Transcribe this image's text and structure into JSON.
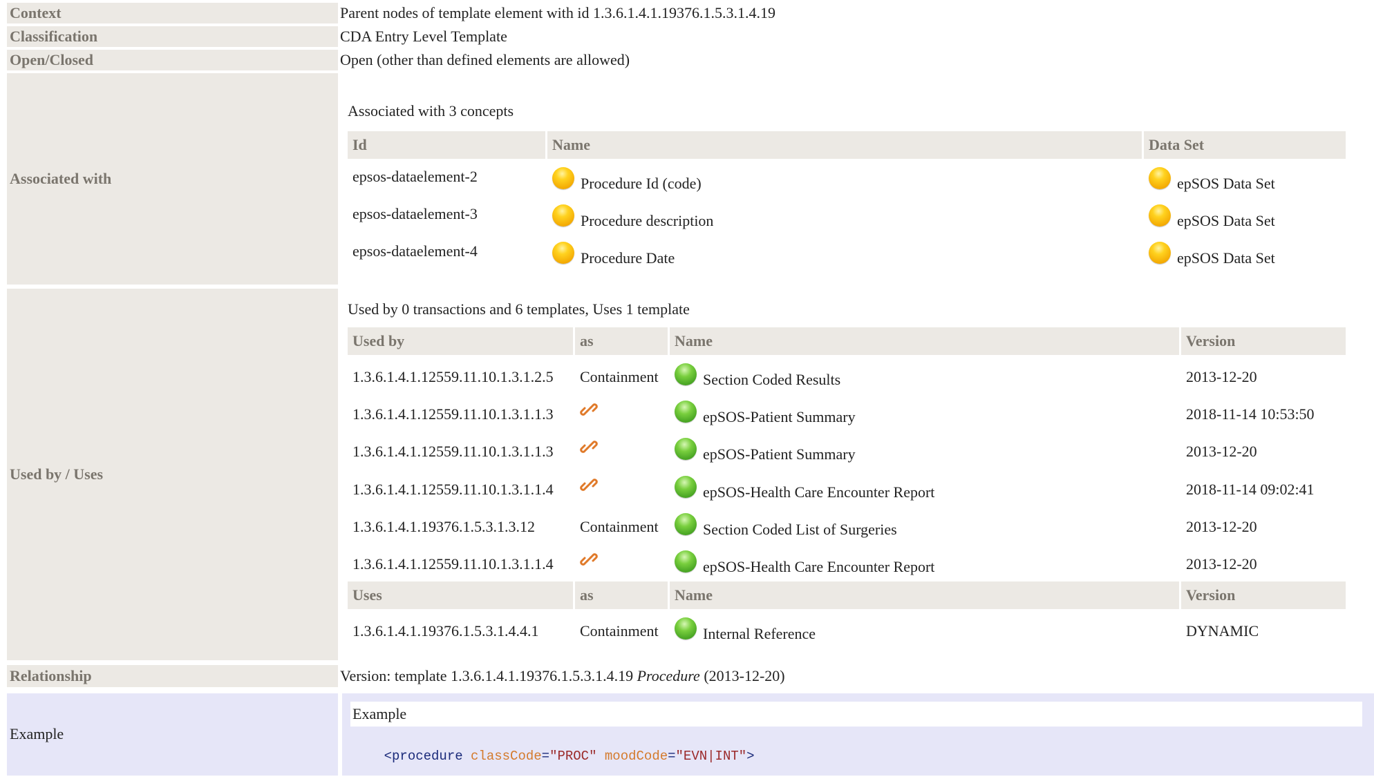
{
  "context": {
    "label": "Context",
    "value": "Parent nodes of template element with id 1.3.6.1.4.1.19376.1.5.3.1.4.19"
  },
  "classification": {
    "label": "Classification",
    "value": "CDA Entry Level Template"
  },
  "openclosed": {
    "label": "Open/Closed",
    "value": "Open (other than defined elements are allowed)"
  },
  "associated": {
    "label": "Associated with",
    "summary": "Associated with 3 concepts",
    "headers": {
      "id": "Id",
      "name": "Name",
      "dataset": "Data Set"
    },
    "rows": [
      {
        "id": "epsos-dataelement-2",
        "name": "Procedure Id (code)",
        "dataset": "epSOS Data Set"
      },
      {
        "id": "epsos-dataelement-3",
        "name": "Procedure description",
        "dataset": "epSOS Data Set"
      },
      {
        "id": "epsos-dataelement-4",
        "name": "Procedure Date",
        "dataset": "epSOS Data Set"
      }
    ]
  },
  "usedby": {
    "label": "Used by / Uses",
    "summary": "Used by 0 transactions and 6 templates, Uses 1 template",
    "headers": {
      "usedby": "Used by",
      "as": "as",
      "name": "Name",
      "version": "Version"
    },
    "rows": [
      {
        "id": "1.3.6.1.4.1.12559.11.10.1.3.1.2.5",
        "as": "Containment",
        "name": "Section Coded Results",
        "version": "2013-12-20",
        "link": false
      },
      {
        "id": "1.3.6.1.4.1.12559.11.10.1.3.1.1.3",
        "as": "",
        "name": "epSOS-Patient Summary",
        "version": "2018-11-14 10:53:50",
        "link": true
      },
      {
        "id": "1.3.6.1.4.1.12559.11.10.1.3.1.1.3",
        "as": "",
        "name": "epSOS-Patient Summary",
        "version": "2013-12-20",
        "link": true
      },
      {
        "id": "1.3.6.1.4.1.12559.11.10.1.3.1.1.4",
        "as": "",
        "name": "epSOS-Health Care Encounter Report",
        "version": "2018-11-14 09:02:41",
        "link": true
      },
      {
        "id": "1.3.6.1.4.1.19376.1.5.3.1.3.12",
        "as": "Containment",
        "name": "Section Coded List of Surgeries",
        "version": "2013-12-20",
        "link": false
      },
      {
        "id": "1.3.6.1.4.1.12559.11.10.1.3.1.1.4",
        "as": "",
        "name": "epSOS-Health Care Encounter Report",
        "version": "2013-12-20",
        "link": true
      }
    ],
    "uses_headers": {
      "uses": "Uses",
      "as": "as",
      "name": "Name",
      "version": "Version"
    },
    "uses_rows": [
      {
        "id": "1.3.6.1.4.1.19376.1.5.3.1.4.4.1",
        "as": "Containment",
        "name": "Internal Reference",
        "version": "DYNAMIC"
      }
    ]
  },
  "relationship": {
    "label": "Relationship",
    "prefix": "Version: template 1.3.6.1.4.1.19376.1.5.3.1.4.19 ",
    "name": "Procedure",
    "suffix": " (2013-12-20)"
  },
  "example": {
    "label": "Example",
    "title": "Example",
    "code": {
      "tag": "<procedure",
      "attr1": "classCode",
      "val1": "\"PROC\"",
      "attr2": "moodCode",
      "val2": "\"EVN|INT\"",
      "close": ">"
    }
  },
  "colors": {
    "label_bg": "#ece9e4",
    "label_text": "#7a756d",
    "example_bg": "#e6e6f8",
    "status_yellow": "#f5b400",
    "status_green": "#4caf2a",
    "link_orange": "#e07a2a",
    "code_tag": "#1a2a7a",
    "code_attr": "#d47a2c",
    "code_value": "#9b2a2a"
  }
}
